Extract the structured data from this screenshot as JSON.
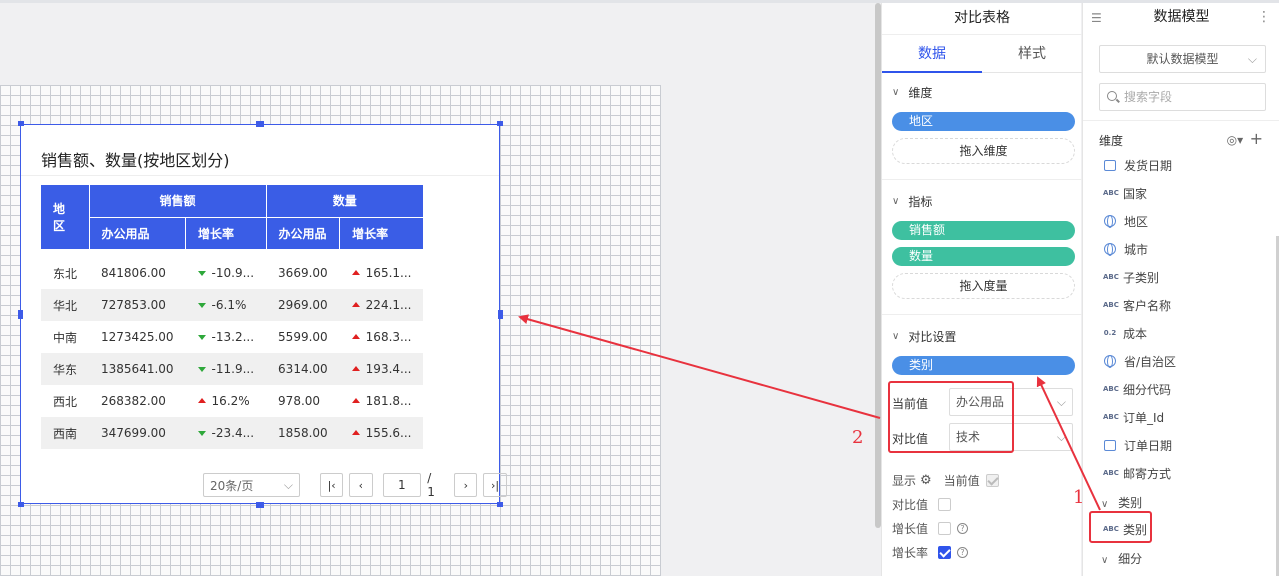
{
  "widget": {
    "title": "销售额、数量(按地区划分)",
    "headers": {
      "region": "地区",
      "sales_group": "销售额",
      "qty_group": "数量",
      "sub_current": "办公用品",
      "sub_rate": "增长率"
    },
    "rows": [
      {
        "region": "东北",
        "sales": "841806.00",
        "sales_rate": "-10.9...",
        "sales_dir": "down",
        "qty": "3669.00",
        "qty_rate": "165.1...",
        "qty_dir": "up"
      },
      {
        "region": "华北",
        "sales": "727853.00",
        "sales_rate": "-6.1%",
        "sales_dir": "down",
        "qty": "2969.00",
        "qty_rate": "224.1...",
        "qty_dir": "up"
      },
      {
        "region": "中南",
        "sales": "1273425.00",
        "sales_rate": "-13.2...",
        "sales_dir": "down",
        "qty": "5599.00",
        "qty_rate": "168.3...",
        "qty_dir": "up"
      },
      {
        "region": "华东",
        "sales": "1385641.00",
        "sales_rate": "-11.9...",
        "sales_dir": "down",
        "qty": "6314.00",
        "qty_rate": "193.4...",
        "qty_dir": "up"
      },
      {
        "region": "西北",
        "sales": "268382.00",
        "sales_rate": "16.2%",
        "sales_dir": "up",
        "qty": "978.00",
        "qty_rate": "181.8...",
        "qty_dir": "up"
      },
      {
        "region": "西南",
        "sales": "347699.00",
        "sales_rate": "-23.4...",
        "sales_dir": "down",
        "qty": "1858.00",
        "qty_rate": "155.6...",
        "qty_dir": "up"
      }
    ],
    "pager": {
      "page_size": "20条/页",
      "page": "1",
      "total": "/ 1",
      "first": "|‹",
      "prev": "‹",
      "next": "›",
      "last": "›|"
    }
  },
  "config": {
    "title": "对比表格",
    "tabs": [
      "数据",
      "样式"
    ],
    "dimension": {
      "label": "维度",
      "pill": "地区",
      "drop": "拖入维度"
    },
    "measure": {
      "label": "指标",
      "pills": [
        "销售额",
        "数量"
      ],
      "drop": "拖入度量"
    },
    "compare": {
      "label": "对比设置",
      "pill": "类别",
      "current_label": "当前值",
      "current_value": "办公用品",
      "compare_label": "对比值",
      "compare_value": "技术"
    },
    "display": {
      "label": "显示",
      "current": "当前值",
      "compare": "对比值",
      "growth_value": "增长值",
      "growth_rate": "增长率"
    }
  },
  "model": {
    "title": "数据模型",
    "select": "默认数据模型",
    "search_placeholder": "搜索字段",
    "dim_label": "维度",
    "fields": [
      {
        "icon": "cal",
        "name": "发货日期"
      },
      {
        "icon": "abc",
        "name": "国家"
      },
      {
        "icon": "globe",
        "name": "地区"
      },
      {
        "icon": "globe",
        "name": "城市"
      },
      {
        "icon": "abc",
        "name": "子类别"
      },
      {
        "icon": "abc",
        "name": "客户名称"
      },
      {
        "icon": "num",
        "name": "成本"
      },
      {
        "icon": "globe",
        "name": "省/自治区"
      },
      {
        "icon": "abc",
        "name": "细分代码"
      },
      {
        "icon": "abc",
        "name": "订单_Id"
      },
      {
        "icon": "cal",
        "name": "订单日期"
      },
      {
        "icon": "abc",
        "name": "邮寄方式"
      }
    ],
    "group_category": "类别",
    "group_category_field": "类别",
    "group_segment": "细分",
    "icon_text_abc": "ABC",
    "icon_text_num": "0.2"
  },
  "annotations": {
    "one": "1",
    "two": "2"
  },
  "colors": {
    "accent": "#2f54eb",
    "header": "#3a5de6",
    "pill_blue": "#4a8fe6",
    "pill_green": "#3ec0a0",
    "annotation": "#e8323e",
    "up": "#e02020",
    "down": "#2ea83a"
  }
}
